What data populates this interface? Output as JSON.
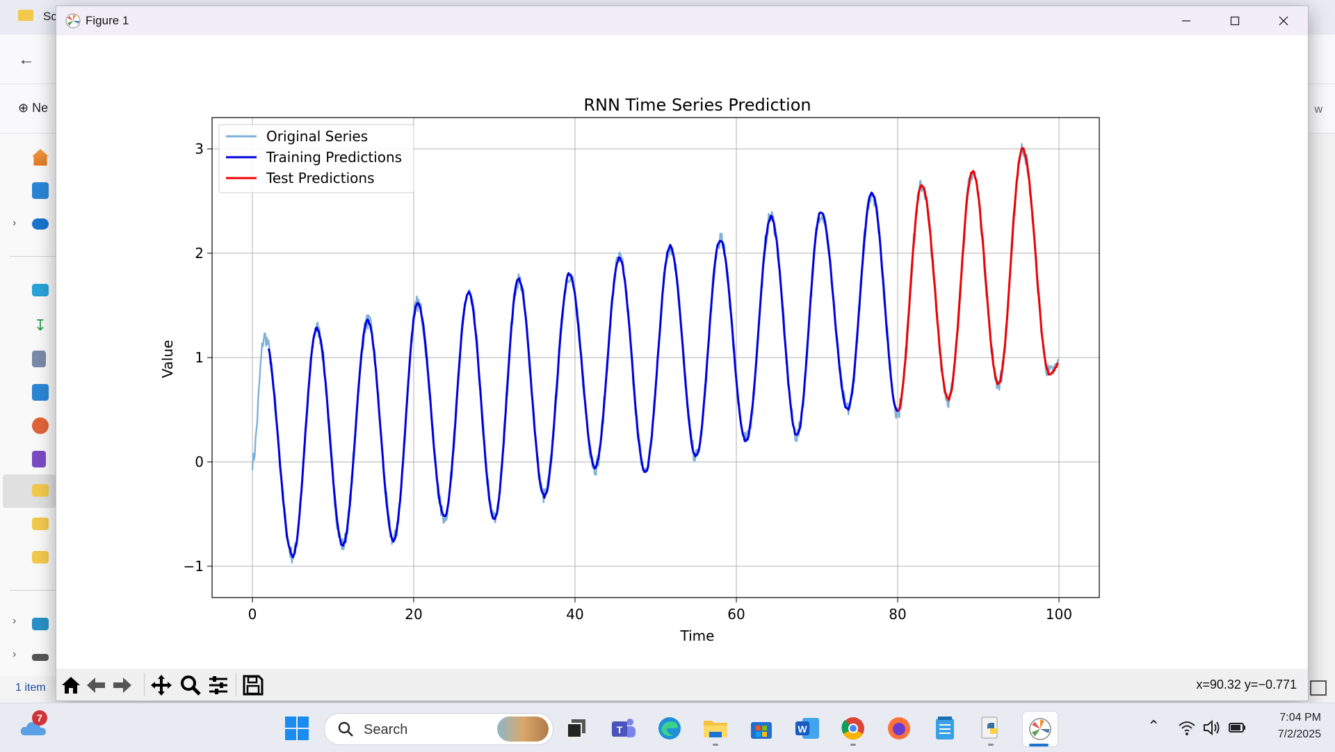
{
  "explorer": {
    "title_clip": "Sc",
    "new_clip": "Ne",
    "right_clip": "w",
    "status": "1 item"
  },
  "window": {
    "title": "Figure 1",
    "buttons": [
      "minimize",
      "maximize",
      "close"
    ]
  },
  "toolbar": {
    "buttons": [
      "home",
      "back",
      "forward",
      "pan",
      "zoom",
      "configure-subplots",
      "save"
    ],
    "coordinate_readout": "x=90.32 y=−0.771"
  },
  "chart_data": {
    "type": "line",
    "title": "RNN Time Series Prediction",
    "xlabel": "Time",
    "ylabel": "Value",
    "xlim": [
      -5,
      105
    ],
    "ylim": [
      -1.3,
      3.3
    ],
    "x_ticks": [
      0,
      20,
      40,
      60,
      80,
      100
    ],
    "x_tick_labels": [
      "0",
      "20",
      "40",
      "60",
      "80",
      "100"
    ],
    "y_ticks": [
      -1,
      0,
      1,
      2,
      3
    ],
    "y_tick_labels": [
      "−1",
      "0",
      "1",
      "2",
      "3"
    ],
    "grid": true,
    "legend_position": "top-left",
    "model": {
      "period": 6.25,
      "amplitude": 1.0,
      "trend_per_unit": 0.01,
      "offset": 0.0,
      "peaks": [
        [
          1.5,
          1.2
        ],
        [
          8,
          1.28
        ],
        [
          14.3,
          1.35
        ],
        [
          20.5,
          1.52
        ],
        [
          26.8,
          1.62
        ],
        [
          33,
          1.75
        ],
        [
          39.3,
          1.8
        ],
        [
          45.5,
          1.95
        ],
        [
          51.8,
          2.07
        ],
        [
          58,
          2.13
        ],
        [
          64.3,
          2.35
        ],
        [
          70.5,
          2.4
        ],
        [
          76.8,
          2.58
        ],
        [
          83,
          2.65
        ],
        [
          89.3,
          2.78
        ],
        [
          95.5,
          3.0
        ]
      ],
      "troughs": [
        [
          5,
          -0.9
        ],
        [
          11.2,
          -0.8
        ],
        [
          17.5,
          -0.75
        ],
        [
          23.8,
          -0.53
        ],
        [
          30,
          -0.55
        ],
        [
          36.2,
          -0.33
        ],
        [
          42.5,
          -0.05
        ],
        [
          48.7,
          -0.1
        ],
        [
          55,
          0.05
        ],
        [
          61.2,
          0.2
        ],
        [
          67.5,
          0.25
        ],
        [
          73.8,
          0.5
        ],
        [
          80,
          0.48
        ],
        [
          86.3,
          0.6
        ],
        [
          92.5,
          0.75
        ],
        [
          98.8,
          0.85
        ]
      ]
    },
    "series": [
      {
        "name": "Original Series",
        "color": "#7fb0d8",
        "x_range": [
          0,
          100
        ],
        "style": "noisy"
      },
      {
        "name": "Training Predictions",
        "color": "#0000dd",
        "x_range": [
          2,
          80
        ],
        "style": "smooth"
      },
      {
        "name": "Test Predictions",
        "color": "#ee0000",
        "x_range": [
          80,
          100
        ],
        "style": "smooth"
      }
    ]
  },
  "taskbar": {
    "weather_badge": "7",
    "search_label": "Search",
    "apps": [
      "start",
      "task-view",
      "teams",
      "edge",
      "file-explorer",
      "microsoft-store",
      "word",
      "chrome",
      "firefox",
      "notepad",
      "python",
      "matplotlib-figure"
    ],
    "time": "7:04 PM",
    "date": "7/2/2025"
  }
}
